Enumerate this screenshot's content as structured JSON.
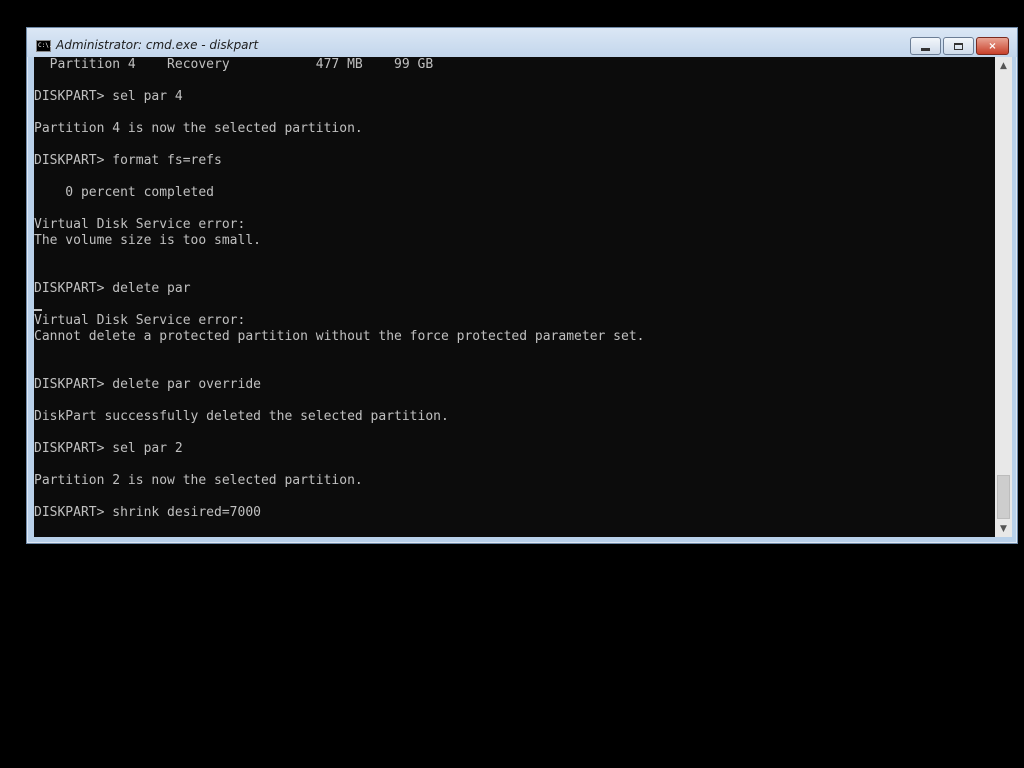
{
  "window": {
    "title": "Administrator: cmd.exe - diskpart",
    "icon": "cmd-icon",
    "icon_text": "C:\\.",
    "controls": {
      "minimize": "minimize-icon",
      "maximize": "maximize-icon",
      "close": "×"
    }
  },
  "console": {
    "lines": [
      "  Partition 4    Recovery           477 MB    99 GB",
      "",
      "DISKPART> sel par 4",
      "",
      "Partition 4 is now the selected partition.",
      "",
      "DISKPART> format fs=refs",
      "",
      "    0 percent completed",
      "",
      "Virtual Disk Service error:",
      "The volume size is too small.",
      "",
      "",
      "DISKPART> delete par",
      "",
      "Virtual Disk Service error:",
      "Cannot delete a protected partition without the force protected parameter set.",
      "",
      "",
      "DISKPART> delete par override",
      "",
      "DiskPart successfully deleted the selected partition.",
      "",
      "DISKPART> sel par 2",
      "",
      "Partition 2 is now the selected partition.",
      "",
      "DISKPART> shrink desired=7000"
    ]
  },
  "scrollbar": {
    "up": "▲",
    "down": "▼",
    "position_fraction": 0.95
  },
  "colors": {
    "console_bg": "#0c0c0c",
    "console_fg": "#c0c0c0"
  }
}
